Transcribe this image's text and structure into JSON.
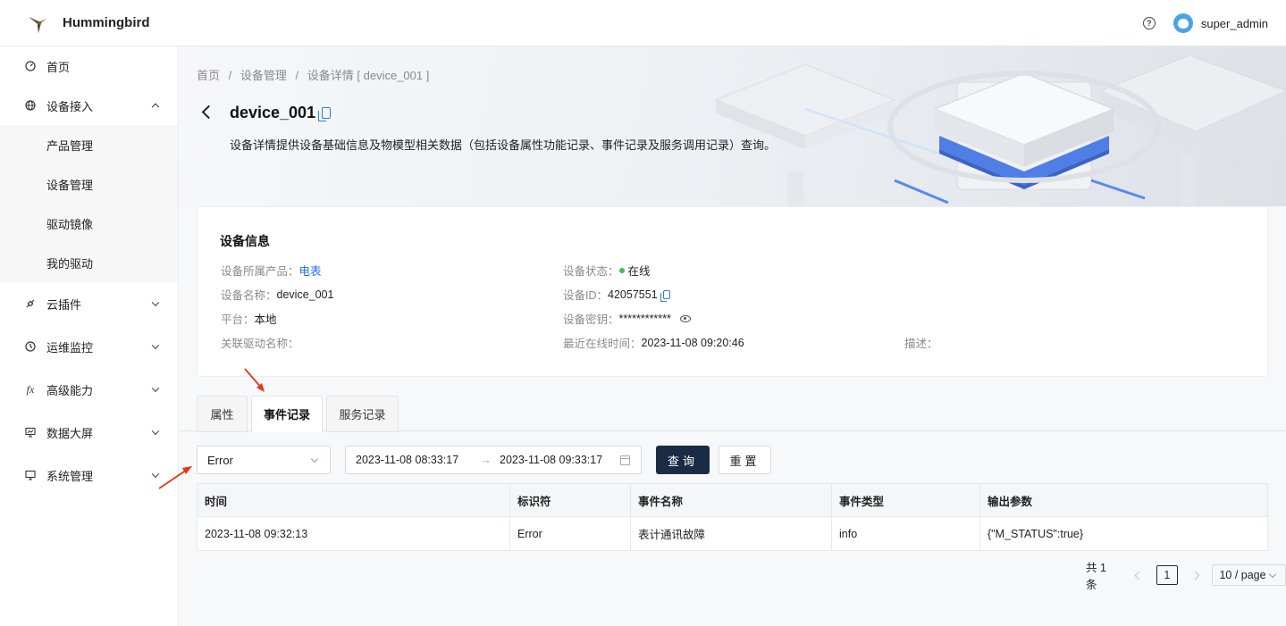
{
  "app": {
    "title": "Hummingbird",
    "user": "super_admin",
    "help_glyph": "?"
  },
  "sidebar": {
    "items": [
      {
        "label": "首页",
        "icon": "dashboard-icon"
      },
      {
        "label": "设备接入",
        "icon": "globe-icon",
        "expanded": true,
        "children": [
          {
            "label": "产品管理"
          },
          {
            "label": "设备管理"
          },
          {
            "label": "驱动镜像"
          },
          {
            "label": "我的驱动"
          }
        ]
      },
      {
        "label": "云插件",
        "icon": "plugin-icon"
      },
      {
        "label": "运维监控",
        "icon": "clock-icon"
      },
      {
        "label": "高级能力",
        "icon": "function-icon",
        "glyph": "fx"
      },
      {
        "label": "数据大屏",
        "icon": "monitor-chart-icon"
      },
      {
        "label": "系统管理",
        "icon": "desktop-icon"
      }
    ]
  },
  "breadcrumb": [
    "首页",
    "/",
    "设备管理",
    "/",
    "设备详情 [ device_001 ]"
  ],
  "header": {
    "device_name": "device_001",
    "description": "设备详情提供设备基础信息及物模型相关数据（包括设备属性功能记录、事件记录及服务调用记录）查询。"
  },
  "device_info": {
    "title": "设备信息",
    "product_label": "设备所属产品：",
    "product_value": "电表",
    "name_label": "设备名称：",
    "name_value": "device_001",
    "platform_label": "平台：",
    "platform_value": "本地",
    "driver_label": "关联驱动名称：",
    "driver_value": "",
    "status_label": "设备状态：",
    "status_value": "在线",
    "id_label": "设备ID：",
    "id_value": "42057551",
    "secret_label": "设备密钥：",
    "secret_value": "************",
    "online_label": "最近在线时间：",
    "online_value": "2023-11-08 09:20:46",
    "desc_label": "描述：",
    "desc_value": "",
    "status_color": "#3cc05a",
    "link_color": "#1f6fe0"
  },
  "tabs": [
    {
      "label": "属性",
      "active": false
    },
    {
      "label": "事件记录",
      "active": true
    },
    {
      "label": "服务记录",
      "active": false
    }
  ],
  "filters": {
    "event_select": "Error",
    "start_time": "2023-11-08 08:33:17",
    "range_separator": "→",
    "end_time": "2023-11-08 09:33:17",
    "query_label": "查询",
    "reset_label": "重置"
  },
  "table": {
    "columns": [
      "时间",
      "标识符",
      "事件名称",
      "事件类型",
      "输出参数"
    ],
    "rows": [
      [
        "2023-11-08 09:32:13",
        "Error",
        "表计通讯故障",
        "info",
        "{\"M_STATUS\":true}"
      ]
    ]
  },
  "pagination": {
    "total": "共 1 条",
    "current": "1",
    "page_size": "10 / page"
  },
  "colors": {
    "primary": "#1b2b45",
    "accent": "#1f6fe0",
    "annotation": "#e8321f"
  }
}
